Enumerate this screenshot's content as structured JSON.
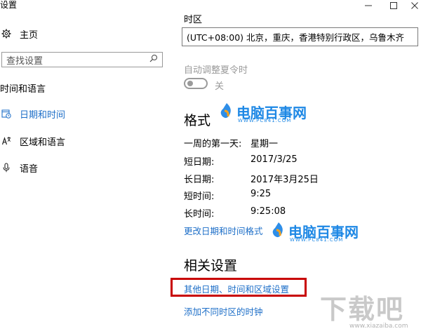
{
  "window": {
    "title": "设置",
    "minimize_glyph": "—",
    "maximize_glyph": "☐",
    "close_glyph": "✕"
  },
  "sidebar": {
    "home_label": "主页",
    "search_placeholder": "查找设置",
    "category": "时间和语言",
    "items": [
      {
        "label": "日期和时间",
        "icon": "calendar-clock-icon",
        "active": true
      },
      {
        "label": "区域和语言",
        "icon": "region-language-icon",
        "active": false
      },
      {
        "label": "语音",
        "icon": "microphone-icon",
        "active": false
      }
    ]
  },
  "main": {
    "timezone_label": "时区",
    "timezone_value": "(UTC+08:00) 北京，重庆，香港特别行政区，乌鲁木齐",
    "dst_label": "自动调整夏令时",
    "dst_toggle_label": "关",
    "format_heading": "格式",
    "format_rows": [
      {
        "label": "一周的第一天:",
        "value": "星期一"
      },
      {
        "label": "短日期:",
        "value": "2017/3/25"
      },
      {
        "label": "长日期:",
        "value": "2017年3月25日"
      },
      {
        "label": "短时间:",
        "value": "9:25"
      },
      {
        "label": "长时间:",
        "value": "9:25:08"
      }
    ],
    "change_format_link": "更改日期和时间格式",
    "related_heading": "相关设置",
    "related_links": [
      "其他日期、时间和区域设置",
      "添加不同时区的时钟"
    ]
  },
  "watermarks": {
    "site_name": "电脑百事网",
    "site_url": "WWW.PC841.COM",
    "corner_logo": "下载吧",
    "corner_url": "www.xiazaiba.com"
  },
  "colors": {
    "accent": "#1e6fc8",
    "highlight": "#c80000",
    "muted": "#9a9a9a"
  }
}
